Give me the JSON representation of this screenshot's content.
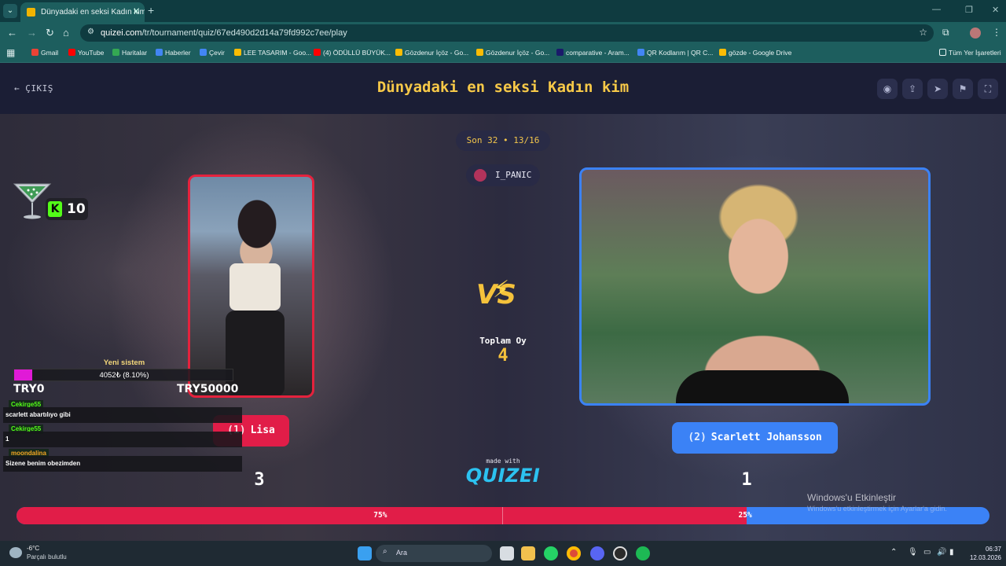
{
  "browser": {
    "tab_title": "Dünyadaki en seksi Kadın kim",
    "url_host": "quizei.com",
    "url_path": "/tr/tournament/quiz/67ed490d2d14a79fd992c7ee/play",
    "bookmarks": [
      "Gmail",
      "YouTube",
      "Haritalar",
      "Haberler",
      "Çevir",
      "LEE TASARIM - Goo...",
      "(4) ÖDÜLLÜ BÜYÜK...",
      "Gözdenur İçöz - Go...",
      "Gözdenur İçöz - Go...",
      "comparative - Aram...",
      "QR Kodlarım | QR C...",
      "gözde - Google Drive"
    ],
    "all_bookmarks": "Tüm Yer İşaretleri"
  },
  "header": {
    "exit_label": "ÇIKIŞ",
    "title": "Dünyadaki en seksi Kadın kim"
  },
  "match": {
    "round": "Son 32 • 13/16",
    "user": "I_PANIC",
    "total_label": "Toplam Oy",
    "total_votes": "4",
    "left": {
      "seed": "(1)",
      "name": "Lisa",
      "votes": "3",
      "percent_label": "75%",
      "percent": 75
    },
    "right": {
      "seed": "(2)",
      "name": "Scarlett Johansson",
      "votes": "1",
      "percent_label": "25%",
      "percent": 25
    }
  },
  "made_with": "made with",
  "logo_text": "QUIZEI",
  "overlay": {
    "kick_count": "10",
    "goal_title": "Yeni sistem",
    "goal_progress": "4052₺ (8.10%)",
    "goal_fraction": 0.081,
    "goal_min": "TRY0",
    "goal_max": "TRY50000",
    "chat": [
      {
        "user": "Cekirge55",
        "text": "scarlett abartılıyo gibi",
        "color": "#53fc18"
      },
      {
        "user": "Cekirge55",
        "text": "1",
        "color": "#53fc18"
      },
      {
        "user": "moondalina",
        "text": "Sizene benim obezimden",
        "color": "#f5a623"
      }
    ]
  },
  "windows_activate": {
    "title": "Windows'u Etkinleştir",
    "subtitle": "Windows'u etkinleştirmek için Ayarlar'a gidin."
  },
  "taskbar": {
    "temp": "-6°C",
    "condition": "Parçalı bulutlu",
    "search": "Ara",
    "time": "06:37",
    "date": "12.03.2026"
  }
}
